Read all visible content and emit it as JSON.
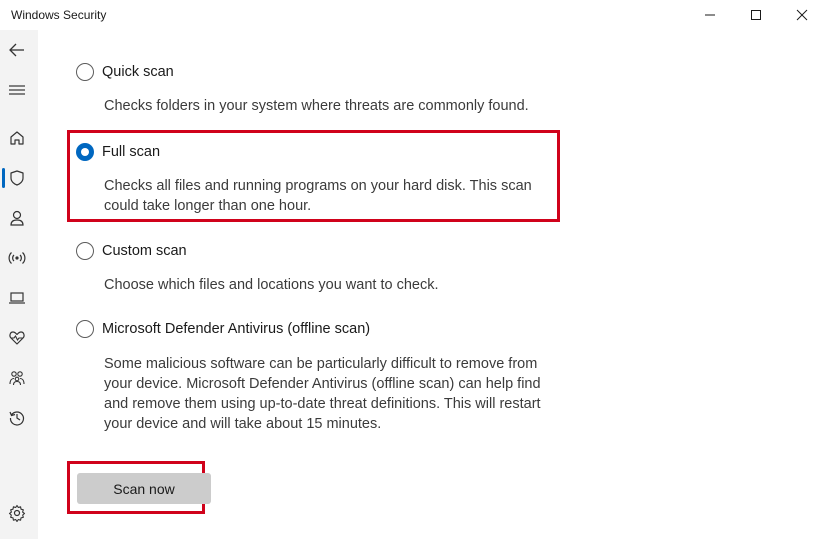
{
  "window": {
    "title": "Windows Security",
    "controls": [
      "minimize-icon",
      "maximize-icon",
      "close-icon"
    ]
  },
  "sidebar": {
    "items": [
      {
        "name": "back",
        "icon": "back-arrow-icon"
      },
      {
        "name": "menu",
        "icon": "hamburger-icon"
      },
      {
        "name": "home",
        "icon": "home-icon"
      },
      {
        "name": "virus-protection",
        "icon": "shield-icon",
        "selected": true
      },
      {
        "name": "account-protection",
        "icon": "person-icon"
      },
      {
        "name": "firewall",
        "icon": "antenna-icon"
      },
      {
        "name": "app-browser-control",
        "icon": "laptop-icon"
      },
      {
        "name": "device-security",
        "icon": "heart-pulse-icon"
      },
      {
        "name": "family-options",
        "icon": "family-icon"
      },
      {
        "name": "protection-history",
        "icon": "history-icon"
      },
      {
        "name": "settings",
        "icon": "gear-icon"
      }
    ],
    "accent_color": "#0067c0"
  },
  "scan_options": [
    {
      "label": "Quick scan",
      "description": "Checks folders in your system where threats are commonly found.",
      "selected": false
    },
    {
      "label": "Full scan",
      "description_lines": [
        "Checks all files and running programs on your hard disk. This scan",
        "could take longer than one hour."
      ],
      "selected": true
    },
    {
      "label": "Custom scan",
      "description": "Choose which files and locations you want to check.",
      "selected": false
    },
    {
      "label": "Microsoft Defender Antivirus (offline scan)",
      "description_lines": [
        "Some malicious software can be particularly difficult to remove from",
        "your device. Microsoft Defender Antivirus (offline scan) can help find",
        "and remove them using up-to-date threat definitions. This will restart",
        "your device and will take about 15 minutes."
      ],
      "selected": false
    }
  ],
  "actions": {
    "scan_now_label": "Scan now"
  },
  "highlight_color": "#d0021b"
}
